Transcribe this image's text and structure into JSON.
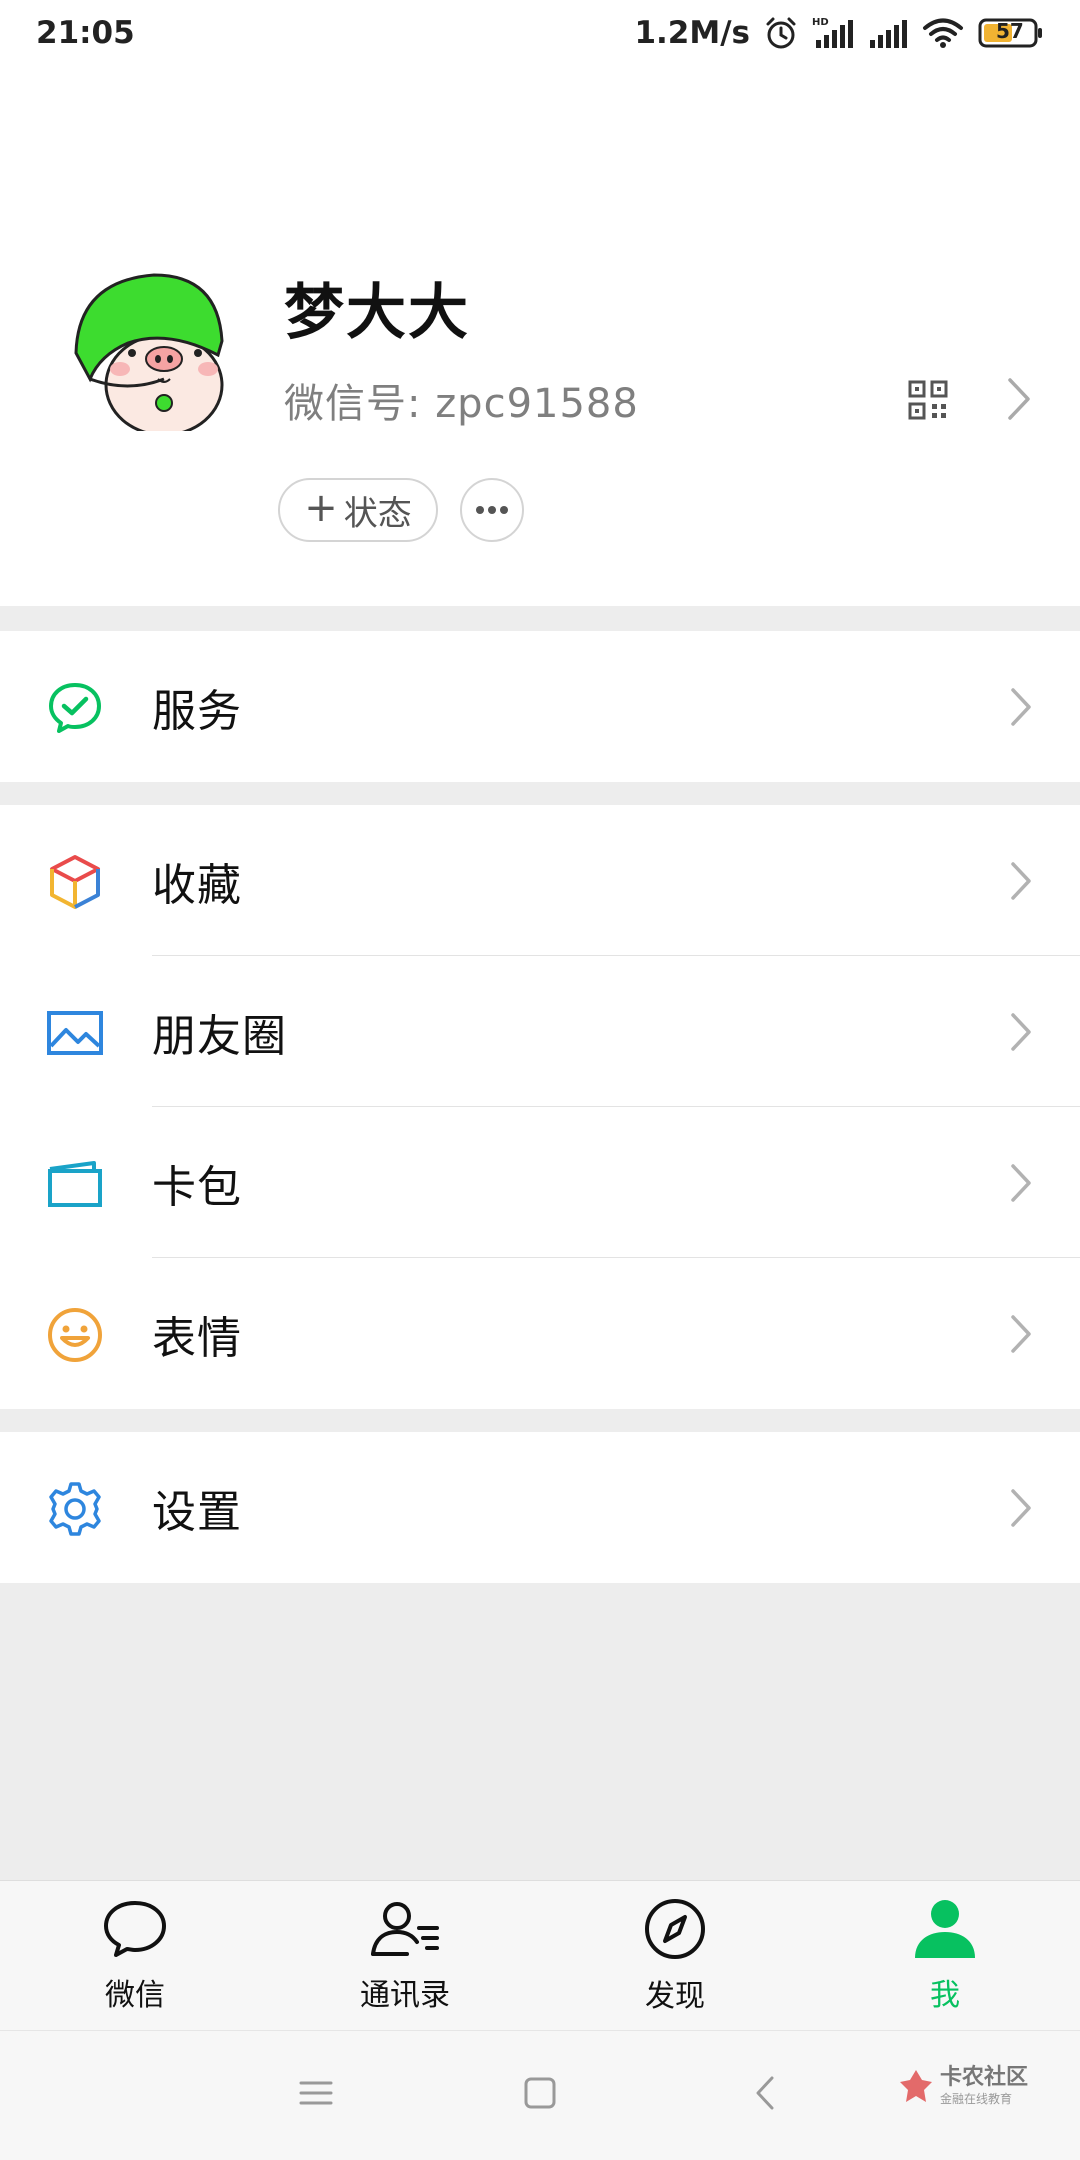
{
  "status_bar": {
    "time": "21:05",
    "net_speed": "1.2M/s",
    "battery": "57"
  },
  "profile": {
    "nickname": "梦大大",
    "wechat_id": "微信号: zpc91588",
    "status_button": "状态"
  },
  "menu": {
    "services": "服务",
    "favorites": "收藏",
    "moments": "朋友圈",
    "cards": "卡包",
    "stickers": "表情",
    "settings": "设置"
  },
  "tabs": [
    {
      "label": "微信",
      "icon": "chat-bubble-icon"
    },
    {
      "label": "通讯录",
      "icon": "contacts-icon"
    },
    {
      "label": "发现",
      "icon": "compass-icon"
    },
    {
      "label": "我",
      "icon": "person-icon",
      "active": true
    }
  ],
  "watermark": {
    "name": "卡农社区",
    "tagline": "金融在线教育"
  },
  "colors": {
    "accent": "#07c160",
    "background": "#ededed"
  }
}
